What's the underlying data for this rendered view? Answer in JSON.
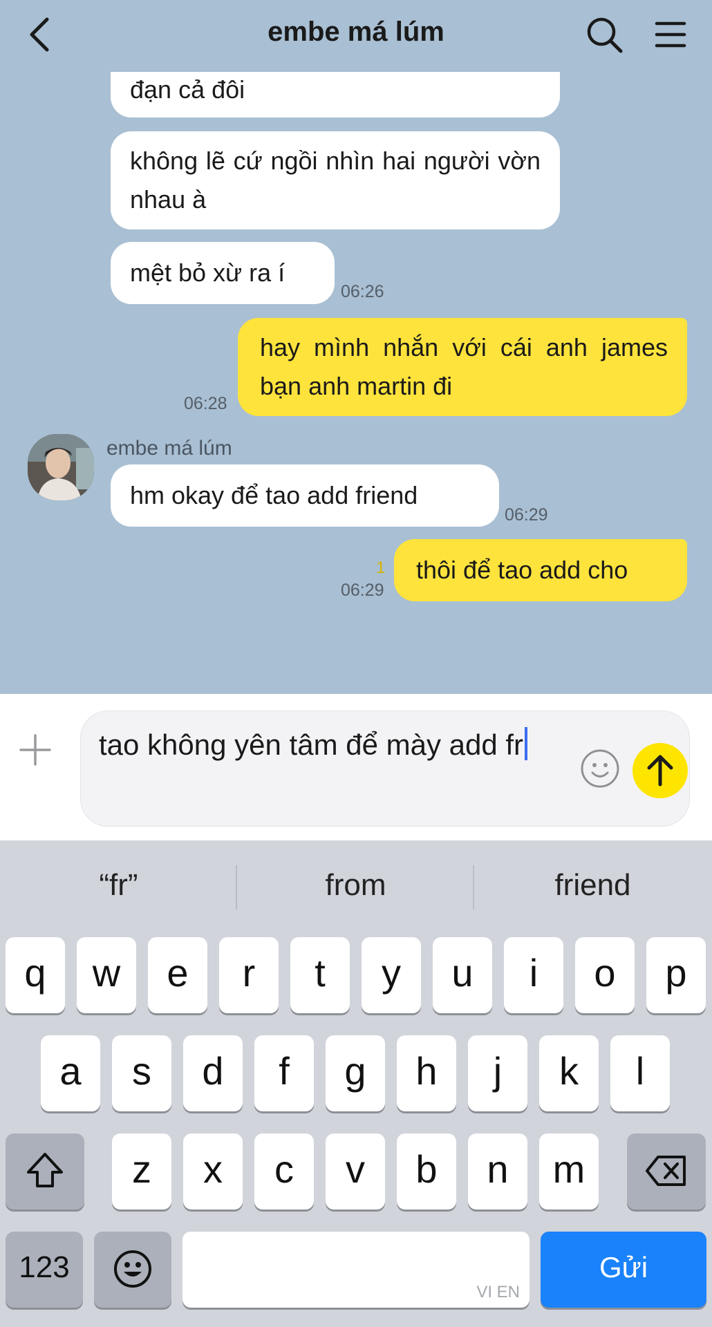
{
  "header": {
    "title": "embe má lúm",
    "back_icon": "chevron-left-icon",
    "search_icon": "search-icon",
    "menu_icon": "hamburger-menu-icon"
  },
  "messages": [
    {
      "from": "other",
      "text": "đạn cả đôi"
    },
    {
      "from": "other",
      "text": "không lẽ cứ ngồi nhìn hai người vờn nhau à"
    },
    {
      "from": "other",
      "text": "mệt bỏ xừ ra í",
      "time": "06:26"
    },
    {
      "from": "me",
      "text": "hay mình nhắn với cái anh james bạn anh martin đi",
      "time": "06:28"
    },
    {
      "from": "other",
      "sender": "embe má lúm",
      "text": "hm okay để tao add friend",
      "time": "06:29"
    },
    {
      "from": "me",
      "text": "thôi để tao add cho",
      "time": "06:29",
      "unread": "1"
    }
  ],
  "composer": {
    "text": "tao không yên tâm để mày add fr",
    "plus_icon": "plus-icon",
    "emoji_icon": "smiley-icon",
    "send_icon": "arrow-up-icon"
  },
  "keyboard": {
    "suggestions": [
      "“fr”",
      "from",
      "friend"
    ],
    "row1": [
      "q",
      "w",
      "e",
      "r",
      "t",
      "y",
      "u",
      "i",
      "o",
      "p"
    ],
    "row2": [
      "a",
      "s",
      "d",
      "f",
      "g",
      "h",
      "j",
      "k",
      "l"
    ],
    "row3": [
      "z",
      "x",
      "c",
      "v",
      "b",
      "n",
      "m"
    ],
    "numbers_key": "123",
    "space_hint": "VI EN",
    "return_key": "Gửi",
    "shift_icon": "shift-icon",
    "backspace_icon": "backspace-icon",
    "emoji_key_icon": "emoji-icon"
  },
  "colors": {
    "chat_background": "#a9bfd3",
    "outgoing_bubble": "#fee33c",
    "incoming_bubble": "#ffffff",
    "send_button": "#fee500",
    "return_key": "#1a82fb"
  }
}
